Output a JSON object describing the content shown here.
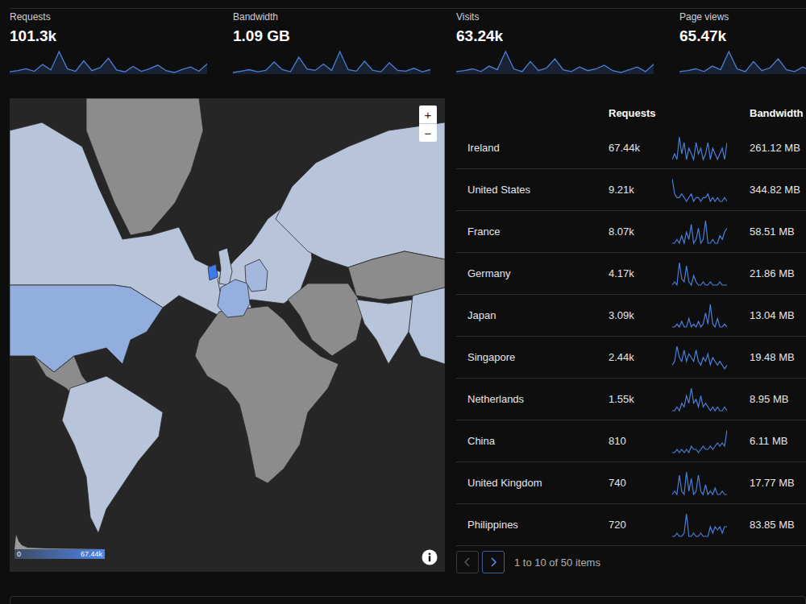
{
  "stats": [
    {
      "label": "Requests",
      "value": "101.3k",
      "series": [
        3.1,
        3.3,
        3.6,
        3.2,
        4.3,
        3.4,
        6.4,
        3.6,
        3.2,
        4.9,
        3.3,
        3.8,
        5.3,
        3.4,
        3.1,
        4.0,
        3.2,
        3.6,
        4.2,
        3.3,
        3.0,
        3.5,
        3.9,
        3.2,
        4.4
      ]
    },
    {
      "label": "Bandwidth",
      "value": "1.09 GB",
      "series": [
        30,
        32,
        34,
        31,
        33,
        45,
        34,
        31,
        52,
        35,
        33,
        42,
        33,
        60,
        34,
        32,
        46,
        33,
        31,
        44,
        33,
        32,
        36,
        31,
        34
      ]
    },
    {
      "label": "Visits",
      "value": "63.24k",
      "series": [
        2.0,
        2.1,
        2.3,
        2.0,
        2.6,
        2.2,
        4.2,
        2.3,
        2.0,
        3.1,
        2.1,
        2.4,
        3.4,
        2.2,
        2.0,
        2.5,
        2.1,
        2.3,
        2.7,
        2.1,
        1.9,
        2.2,
        2.5,
        2.0,
        2.8
      ]
    },
    {
      "label": "Page views",
      "value": "65.47k",
      "series": [
        2.1,
        2.2,
        2.4,
        2.1,
        2.7,
        2.3,
        4.3,
        2.4,
        2.1,
        3.2,
        2.2,
        2.5,
        3.5,
        2.3,
        2.1,
        2.6,
        2.2,
        2.4,
        2.8,
        2.2,
        2.0,
        2.3,
        2.6,
        2.1,
        2.9
      ]
    }
  ],
  "map": {
    "zoom_in": "+",
    "zoom_out": "−",
    "legend_min": "0",
    "legend_max": "67.44k",
    "regions": [
      {
        "level": 0
      },
      {
        "level": 0.01
      },
      {
        "level": 0.14
      },
      {
        "level": 0
      },
      {
        "level": 0.01
      },
      {
        "level": 0
      },
      {
        "level": 0.01
      },
      {
        "level": 0.011
      },
      {
        "level": 1
      },
      {
        "level": 0.12
      },
      {
        "level": 0.06
      },
      {
        "level": 0.01
      },
      {
        "level": 0
      },
      {
        "level": 0
      },
      {
        "level": 0.01
      },
      {
        "level": 0.015
      }
    ]
  },
  "table": {
    "columns": [
      "Requests",
      "Bandwidth"
    ],
    "rows": [
      {
        "country": "Ireland",
        "requests": "67.44k",
        "bandwidth": "261.12 MB",
        "series": [
          5,
          6,
          5,
          9,
          6,
          8,
          5,
          7,
          6,
          5,
          8,
          6,
          7,
          5,
          6,
          8,
          5,
          7,
          6,
          5,
          6,
          7,
          5,
          8
        ]
      },
      {
        "country": "United States",
        "requests": "9.21k",
        "bandwidth": "344.82 MB",
        "series": [
          9,
          5,
          4,
          4,
          5,
          4,
          3,
          4,
          5,
          3,
          4,
          4,
          3,
          4,
          4,
          5,
          3,
          4,
          3,
          4,
          3,
          3,
          4,
          3
        ]
      },
      {
        "country": "France",
        "requests": "8.07k",
        "bandwidth": "58.51 MB",
        "series": [
          3,
          3,
          4,
          3,
          5,
          3,
          6,
          4,
          8,
          3,
          4,
          7,
          3,
          4,
          9,
          3,
          3,
          4,
          3,
          3,
          5,
          4,
          6,
          7
        ]
      },
      {
        "country": "Germany",
        "requests": "4.17k",
        "bandwidth": "21.86 MB",
        "series": [
          2,
          3,
          2,
          9,
          4,
          3,
          8,
          3,
          2,
          5,
          3,
          2,
          2,
          3,
          2,
          2,
          3,
          2,
          2,
          2,
          3,
          2,
          2,
          2
        ]
      },
      {
        "country": "Japan",
        "requests": "3.09k",
        "bandwidth": "13.04 MB",
        "series": [
          1,
          1,
          2,
          1,
          3,
          1,
          1,
          4,
          1,
          2,
          1,
          3,
          1,
          2,
          6,
          2,
          9,
          2,
          1,
          4,
          1,
          1,
          2,
          1
        ]
      },
      {
        "country": "Singapore",
        "requests": "2.44k",
        "bandwidth": "19.48 MB",
        "series": [
          3,
          4,
          8,
          5,
          4,
          7,
          4,
          6,
          5,
          4,
          7,
          4,
          3,
          5,
          4,
          6,
          3,
          5,
          4,
          3,
          4,
          3,
          2,
          3
        ]
      },
      {
        "country": "Netherlands",
        "requests": "1.55k",
        "bandwidth": "8.95 MB",
        "series": [
          2,
          2,
          3,
          2,
          4,
          3,
          6,
          4,
          8,
          4,
          5,
          3,
          6,
          3,
          4,
          3,
          2,
          3,
          2,
          3,
          2,
          2,
          3,
          2
        ]
      },
      {
        "country": "China",
        "requests": "810",
        "bandwidth": "6.11 MB",
        "series": [
          2,
          2,
          3,
          2,
          3,
          2,
          3,
          2,
          4,
          3,
          3,
          2,
          3,
          4,
          3,
          3,
          4,
          3,
          4,
          5,
          4,
          5,
          4,
          9
        ]
      },
      {
        "country": "United Kingdom",
        "requests": "740",
        "bandwidth": "17.77 MB",
        "series": [
          2,
          3,
          2,
          8,
          3,
          2,
          9,
          3,
          7,
          2,
          3,
          8,
          3,
          2,
          5,
          2,
          3,
          2,
          4,
          2,
          2,
          3,
          2,
          2
        ]
      },
      {
        "country": "Philippines",
        "requests": "720",
        "bandwidth": "83.85 MB",
        "series": [
          2,
          2,
          3,
          2,
          2,
          3,
          9,
          2,
          2,
          3,
          2,
          2,
          3,
          2,
          2,
          2,
          5,
          3,
          5,
          4,
          5,
          3,
          5,
          5
        ]
      }
    ]
  },
  "pagination": {
    "summary": "1 to 10 of 50 items",
    "prev_disabled": true,
    "next_disabled": false
  }
}
